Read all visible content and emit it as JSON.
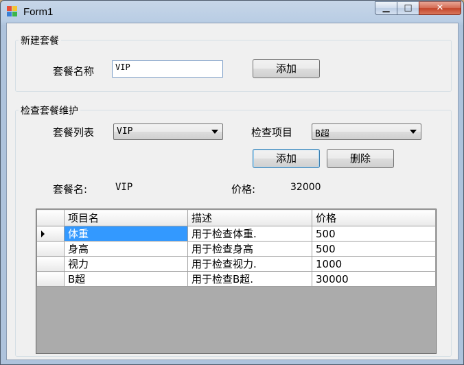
{
  "window": {
    "title": "Form1",
    "min_symbol": "▁",
    "max_symbol": "□",
    "close_symbol": "✕"
  },
  "new_package": {
    "group_title": "新建套餐",
    "name_label": "套餐名称",
    "name_value": "VIP",
    "add_label": "添加"
  },
  "maintenance": {
    "group_title": "检查套餐维护",
    "list_label": "套餐列表",
    "list_selected": "VIP",
    "item_label": "检查项目",
    "item_selected": "B超",
    "add_label": "添加",
    "delete_label": "删除",
    "package_name_label": "套餐名:",
    "package_name_value": "VIP",
    "price_label": "价格:",
    "price_value": "32000"
  },
  "grid": {
    "columns": [
      "项目名",
      "描述",
      "价格"
    ],
    "rows": [
      [
        "体重",
        "用于检查体重.",
        "500"
      ],
      [
        "身高",
        "用于检查身高",
        "500"
      ],
      [
        "视力",
        "用于检查视力.",
        "1000"
      ],
      [
        "B超",
        "用于检查B超.",
        "30000"
      ]
    ]
  },
  "colors": {
    "selection": "#3399ff",
    "grid_empty": "#ababab",
    "form_bg": "#f0f0f0"
  }
}
